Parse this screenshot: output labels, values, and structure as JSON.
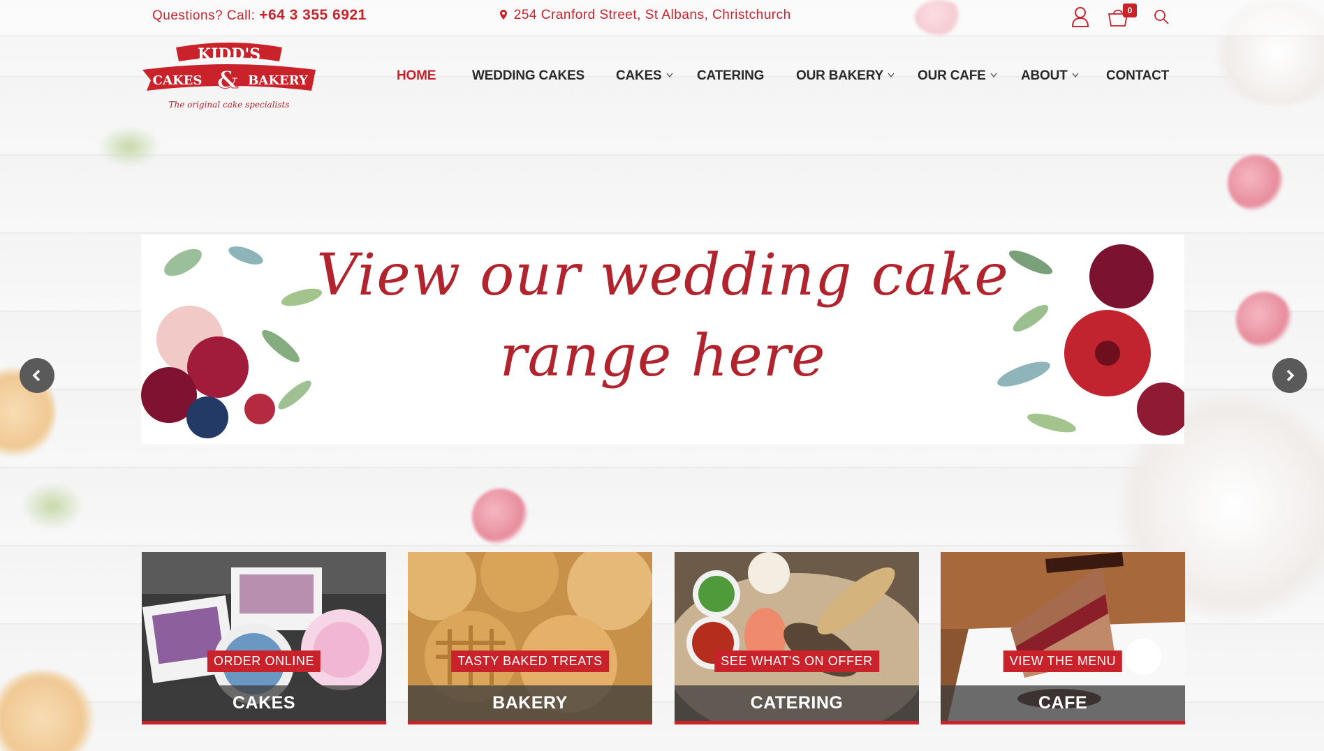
{
  "topbar": {
    "phone_label": "Questions? Call:",
    "phone_number": "+64 3 355 6921",
    "address": "254 Cranford Street, St Albans, Christchurch",
    "cart_count": "0"
  },
  "logo": {
    "line1": "KIDD'S",
    "line2_left": "CAKES",
    "line2_mid": "&",
    "line2_right": "BAKERY",
    "tagline": "The original cake specialists"
  },
  "nav": {
    "items": [
      {
        "label": "HOME",
        "active": true
      },
      {
        "label": "WEDDING CAKES"
      },
      {
        "label": "CAKES",
        "dropdown": true
      },
      {
        "label": "CATERING"
      },
      {
        "label": "OUR BAKERY",
        "dropdown": true
      },
      {
        "label": "OUR CAFE",
        "dropdown": true
      },
      {
        "label": "ABOUT",
        "dropdown": true
      },
      {
        "label": "CONTACT"
      }
    ]
  },
  "hero": {
    "line1": "View our wedding cake",
    "line2": "range here"
  },
  "cards": [
    {
      "tag": "ORDER ONLINE",
      "title": "CAKES"
    },
    {
      "tag": "TASTY BAKED TREATS",
      "title": "BAKERY"
    },
    {
      "tag": "SEE WHAT'S ON OFFER",
      "title": "CATERING"
    },
    {
      "tag": "VIEW THE MENU",
      "title": "CAFE"
    }
  ],
  "colors": {
    "brand_red": "#c9222b",
    "nav_text": "#2a2a2a",
    "card_title_bg": "#3c3c3c"
  }
}
